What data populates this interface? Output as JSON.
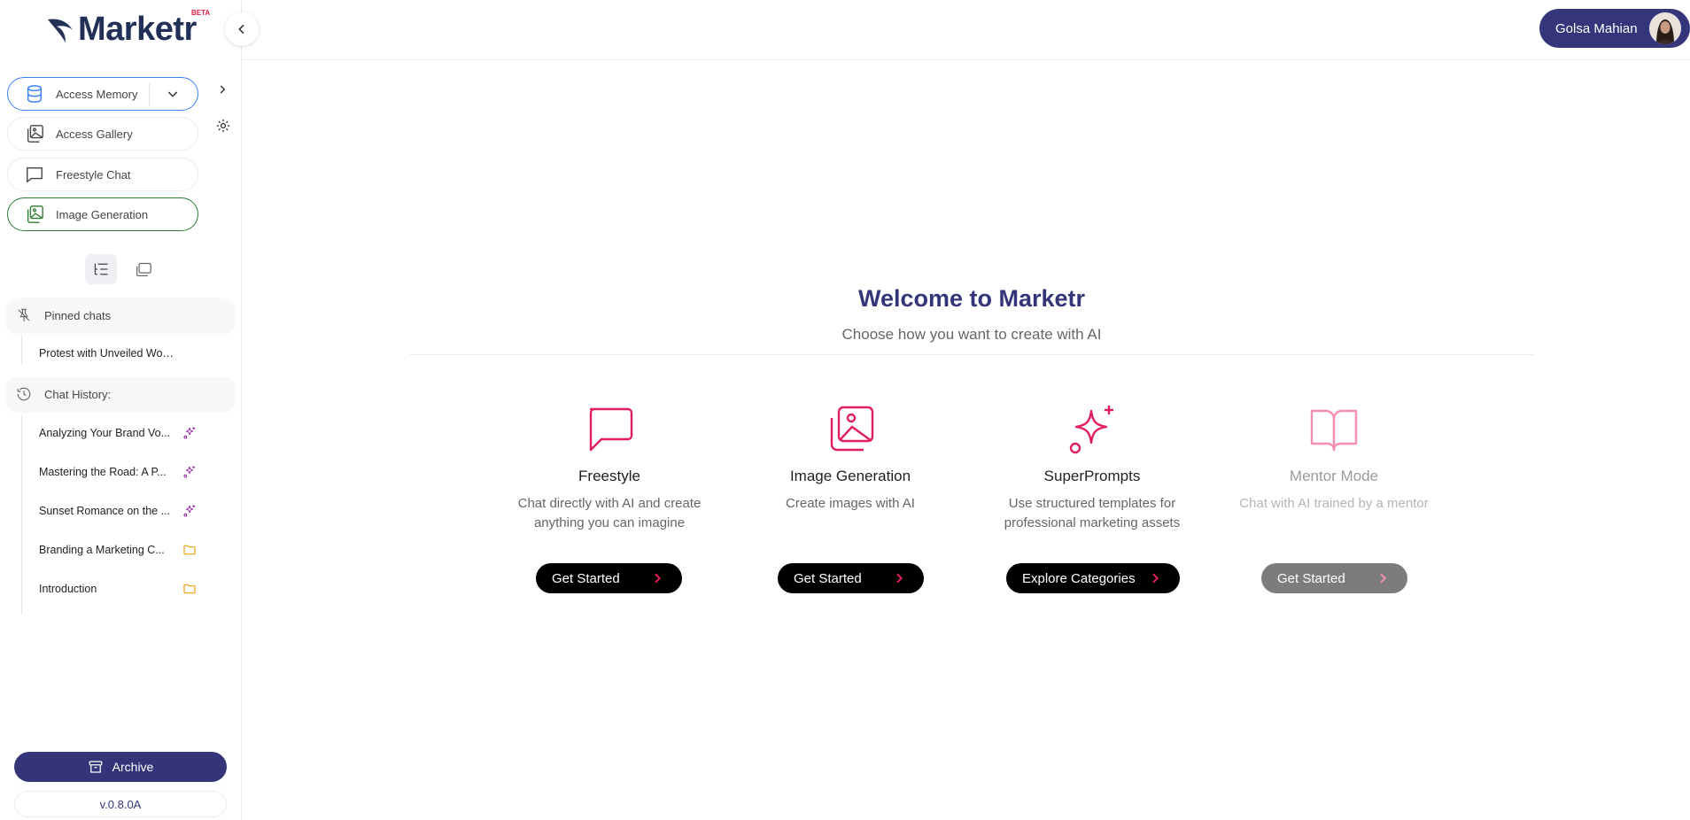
{
  "brand": {
    "logo_text": "Marketr",
    "badge": "BETA"
  },
  "sidebar": {
    "nav": [
      {
        "label": "Access Memory",
        "icon": "database-icon"
      },
      {
        "label": "Access Gallery",
        "icon": "gallery-icon"
      },
      {
        "label": "Freestyle Chat",
        "icon": "chat-bubble-icon"
      },
      {
        "label": "Image Generation",
        "icon": "image-icon"
      }
    ],
    "pinned_header": "Pinned chats",
    "pinned": [
      {
        "title": "Protest with Unveiled Women..."
      }
    ],
    "history_header": "Chat History:",
    "history": [
      {
        "title": "Analyzing Your Brand Vo...",
        "badge": "sparkle-icon"
      },
      {
        "title": "Mastering the Road: A P...",
        "badge": "sparkle-icon"
      },
      {
        "title": "Sunset Romance on the ...",
        "badge": "sparkle-icon"
      },
      {
        "title": "Branding a Marketing C...",
        "badge": "folder-icon"
      },
      {
        "title": "Introduction",
        "badge": "folder-icon"
      }
    ],
    "archive_label": "Archive",
    "version": "v.0.8.0A"
  },
  "header": {
    "user_name": "Golsa Mahian"
  },
  "main": {
    "title": "Welcome to Marketr",
    "subtitle": "Choose how you want to create with AI",
    "cards": [
      {
        "title": "Freestyle",
        "desc": "Chat directly with AI and create anything you can imagine",
        "cta": "Get Started",
        "icon": "chat-bubble-icon"
      },
      {
        "title": "Image Generation",
        "desc": "Create images with AI",
        "cta": "Get Started",
        "icon": "image-icon"
      },
      {
        "title": "SuperPrompts",
        "desc": "Use structured templates for professional marketing assets",
        "cta": "Explore Categories",
        "icon": "sparkle-icon"
      },
      {
        "title": "Mentor Mode",
        "desc": "Chat with AI trained by a mentor",
        "cta": "Get Started",
        "icon": "book-icon"
      }
    ]
  },
  "colors": {
    "brand_navy": "#343579",
    "accent_pink": "#e11d63",
    "memory_border": "#3b82f6",
    "imggen_border": "#2e7d32",
    "history_sparkle": "#9c27b0",
    "history_folder": "#f59e0b"
  }
}
